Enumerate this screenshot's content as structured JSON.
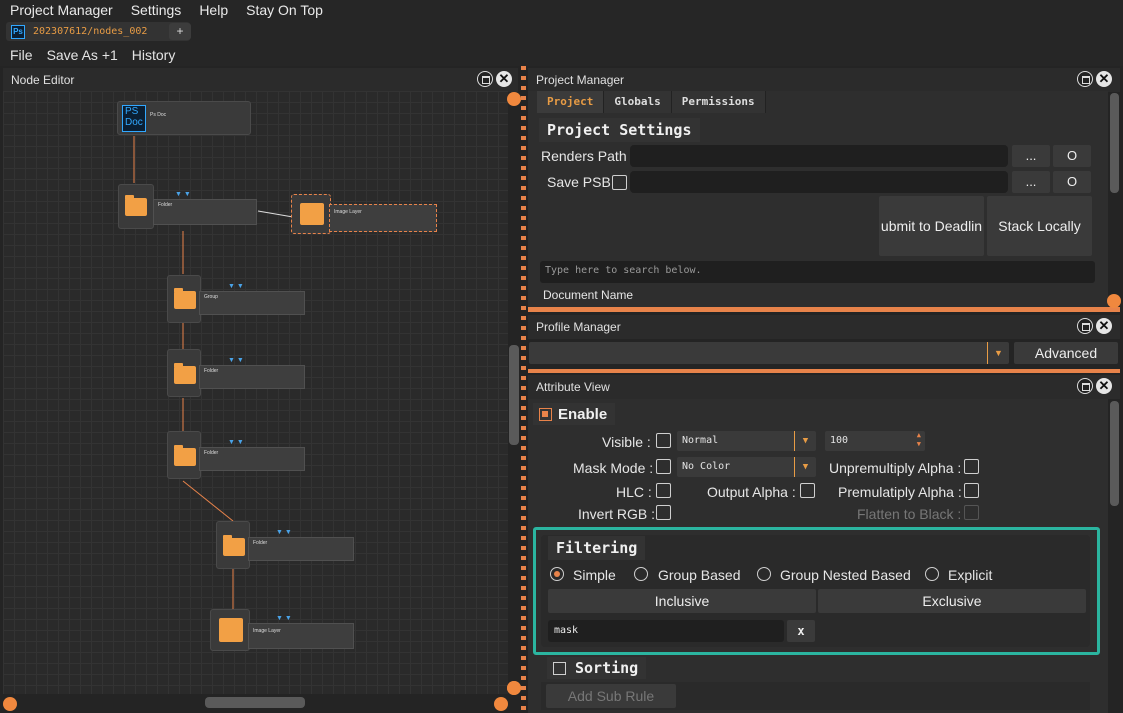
{
  "menubar": {
    "items": [
      "Project Manager",
      "Settings",
      "Help",
      "Stay On Top"
    ]
  },
  "tabs": {
    "document": "202307612/nodes_002",
    "add": "+",
    "icon": "Ps"
  },
  "filemenu": {
    "items": [
      "File",
      "Save As +1",
      "History"
    ]
  },
  "node_editor": {
    "title": "Node Editor",
    "ps_doc_label": "PS\nDoc",
    "nodes": [
      "Ps Doc",
      "Folder",
      "Image Layer",
      "Group",
      "Folder",
      "Folder",
      "Folder",
      "Image Layer"
    ]
  },
  "project_manager": {
    "title": "Project Manager",
    "tabs": [
      "Project",
      "Globals",
      "Permissions"
    ],
    "section": "Project Settings",
    "renders_path_label": "Renders Path :",
    "save_psb_label": "Save PSB",
    "browse": "...",
    "open": "O",
    "submit_button": "ubmit to Deadlin",
    "stack_button": "Stack Locally",
    "search_placeholder": "Type here to search below.",
    "column_header": "Document Name"
  },
  "profile_manager": {
    "title": "Profile Manager",
    "advanced": "Advanced"
  },
  "attribute_view": {
    "title": "Attribute View",
    "enable": "Enable",
    "visible": "Visible :",
    "blend_mode": "Normal",
    "opacity": "100",
    "mask_mode": "Mask Mode :",
    "mask_color": "No Color",
    "unpremultiply": "Unpremultiply Alpha :",
    "hlc": "HLC :",
    "output_alpha": "Output Alpha :",
    "premultiply": "Premulatiply Alpha :",
    "invert_rgb": "Invert RGB :",
    "flatten": "Flatten to Black :",
    "filtering": "Filtering",
    "radios": [
      "Simple",
      "Group Based",
      "Group Nested Based",
      "Explicit"
    ],
    "inclusive": "Inclusive",
    "exclusive": "Exclusive",
    "filter_text": "mask",
    "clear": "x",
    "sorting": "Sorting",
    "add_sub_rule": "Add Sub Rule"
  },
  "colors": {
    "accent": "#e8834a",
    "highlight": "#2bb5a0",
    "ps_blue": "#31a8ff"
  }
}
